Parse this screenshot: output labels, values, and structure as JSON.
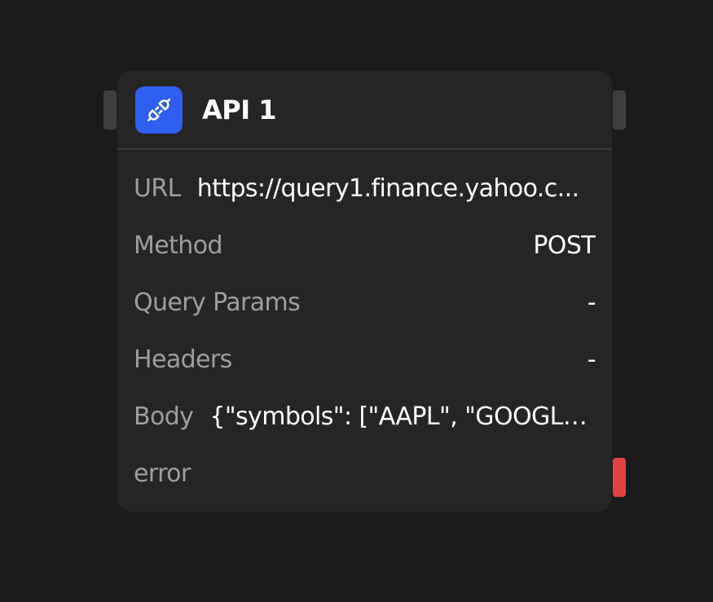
{
  "node": {
    "icon": "plug-icon",
    "title": "API 1",
    "accent_color": "#2e5ff0",
    "error_handle_color": "#e5413f",
    "fields": [
      {
        "label": "URL",
        "value": "https://query1.finance.yahoo.c..."
      },
      {
        "label": "Method",
        "value": "POST"
      },
      {
        "label": "Query Params",
        "value": "-"
      },
      {
        "label": "Headers",
        "value": "-"
      },
      {
        "label": "Body",
        "value": "{\"symbols\": [\"AAPL\", \"GOOGL\"]..."
      }
    ],
    "error_label": "error"
  }
}
